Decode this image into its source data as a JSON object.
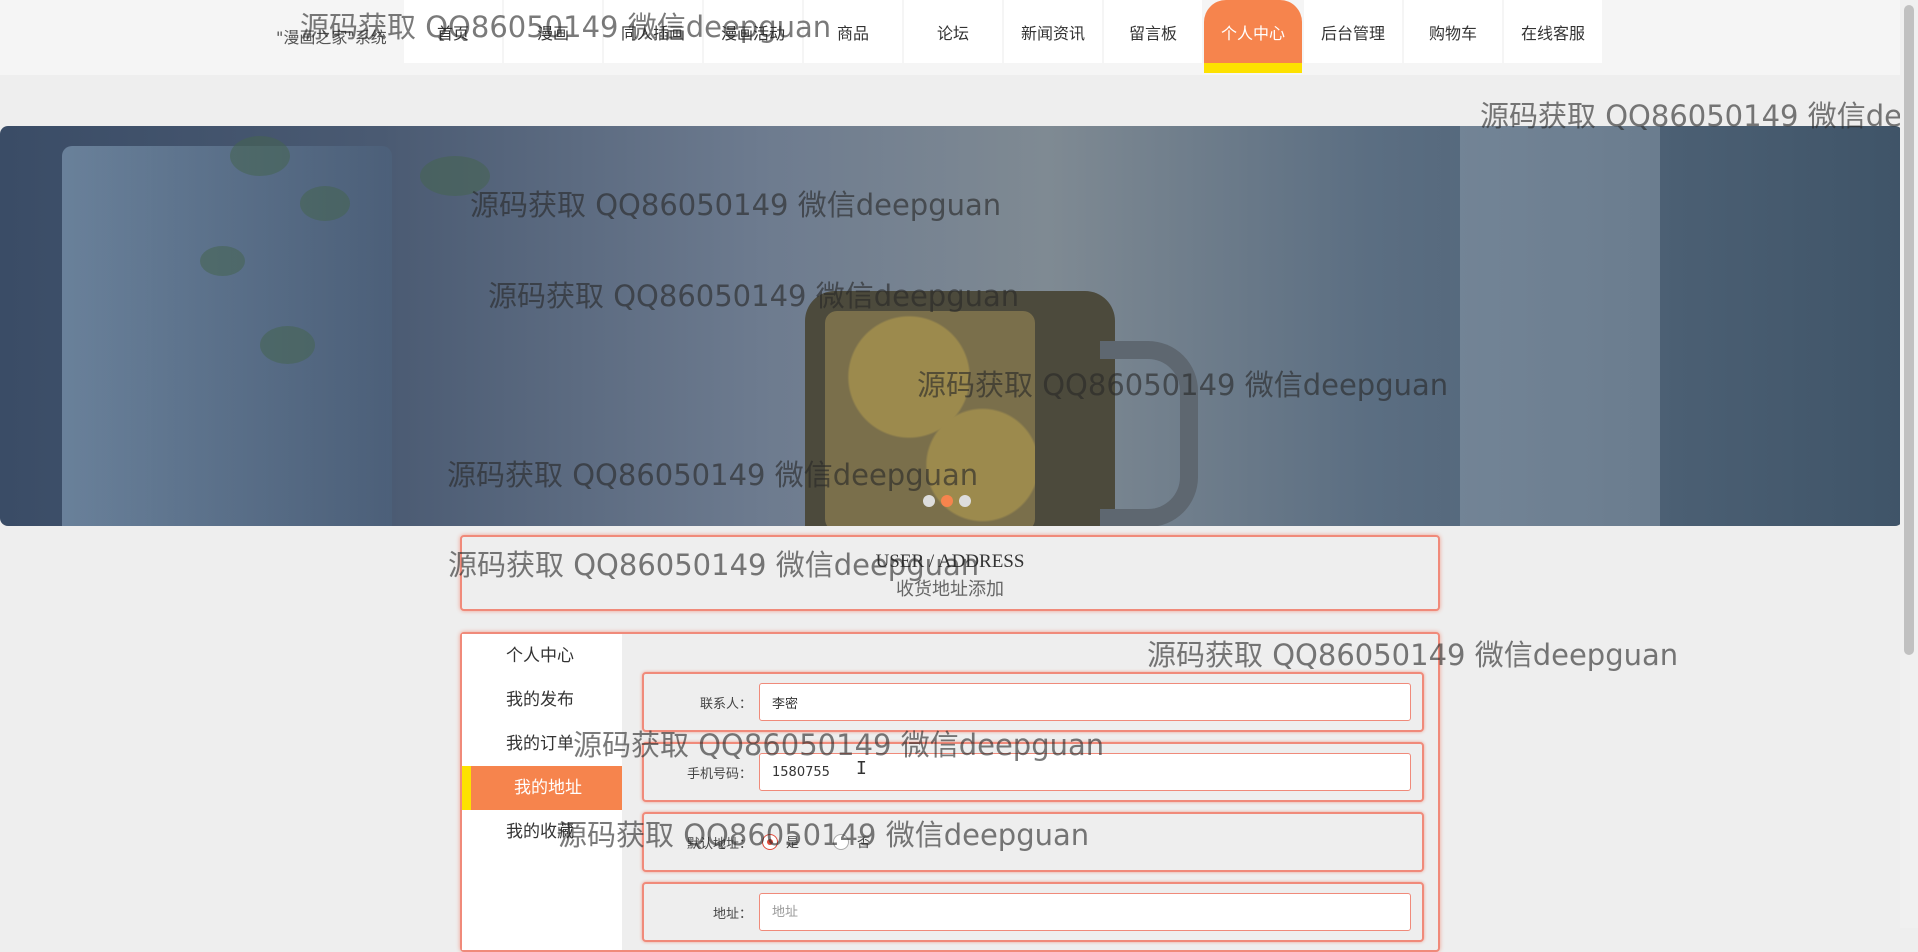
{
  "header": {
    "brand": "\"漫画之家\"系统",
    "nav": [
      {
        "label": "首页",
        "active": false
      },
      {
        "label": "漫画",
        "active": false
      },
      {
        "label": "同人插画",
        "active": false
      },
      {
        "label": "漫画活动",
        "active": false
      },
      {
        "label": "商品",
        "active": false
      },
      {
        "label": "论坛",
        "active": false
      },
      {
        "label": "新闻资讯",
        "active": false
      },
      {
        "label": "留言板",
        "active": false
      },
      {
        "label": "个人中心",
        "active": true
      },
      {
        "label": "后台管理",
        "active": false
      },
      {
        "label": "购物车",
        "active": false
      },
      {
        "label": "在线客服",
        "active": false
      }
    ]
  },
  "banner": {
    "slide_count": 3,
    "active_slide": 2
  },
  "title": {
    "en": "USER / ADDRESS",
    "cn": "收货地址添加"
  },
  "sidebar": {
    "items": [
      {
        "label": "个人中心",
        "active": false
      },
      {
        "label": "我的发布",
        "active": false
      },
      {
        "label": "我的订单",
        "active": false
      },
      {
        "label": "我的地址",
        "active": true
      },
      {
        "label": "我的收藏",
        "active": false
      }
    ]
  },
  "form": {
    "contact": {
      "label": "联系人：",
      "value": "李密"
    },
    "phone": {
      "label": "手机号码：",
      "value": "1580755"
    },
    "default": {
      "label": "默认地址：",
      "options": [
        "是",
        "否"
      ],
      "selected": "是"
    },
    "address": {
      "label": "地址：",
      "placeholder": "地址"
    }
  },
  "watermark": "源码获取 QQ86050149 微信deepguan",
  "colors": {
    "accent": "#f6844d",
    "highlight": "#fde100",
    "border": "#f08a7a"
  }
}
